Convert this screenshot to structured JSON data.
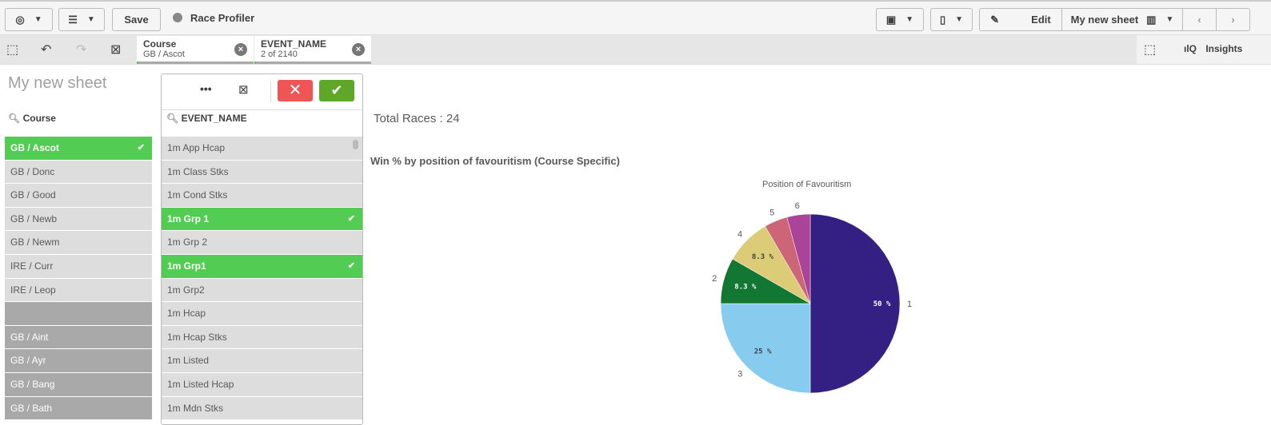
{
  "toolbar": {
    "save": "Save",
    "app_name": "Race Profiler",
    "edit": "Edit",
    "sheet_name": "My new sheet"
  },
  "selections": {
    "chips": [
      {
        "title": "Course",
        "value": "GB / Ascot"
      },
      {
        "title": "EVENT_NAME",
        "value": "2 of 2140"
      }
    ],
    "insights": "Insights"
  },
  "sheet": {
    "title": "My new sheet"
  },
  "course_list": {
    "title": "Course",
    "items": [
      {
        "label": "GB / Ascot",
        "state": "selected"
      },
      {
        "label": "GB / Donc",
        "state": "possible"
      },
      {
        "label": "GB / Good",
        "state": "possible"
      },
      {
        "label": "GB / Newb",
        "state": "possible"
      },
      {
        "label": "GB / Newm",
        "state": "possible"
      },
      {
        "label": "IRE / Curr",
        "state": "possible"
      },
      {
        "label": "IRE / Leop",
        "state": "possible"
      },
      {
        "label": "",
        "state": "alternative"
      },
      {
        "label": "GB / Aint",
        "state": "alternative"
      },
      {
        "label": "GB / Ayr",
        "state": "alternative"
      },
      {
        "label": "GB / Bang",
        "state": "alternative"
      },
      {
        "label": "GB / Bath",
        "state": "alternative"
      }
    ]
  },
  "event_list": {
    "title": "EVENT_NAME",
    "items": [
      {
        "label": "1m App Hcap",
        "state": "possible"
      },
      {
        "label": "1m Class Stks",
        "state": "possible"
      },
      {
        "label": "1m Cond Stks",
        "state": "possible"
      },
      {
        "label": "1m Grp 1",
        "state": "selected"
      },
      {
        "label": "1m Grp 2",
        "state": "possible"
      },
      {
        "label": "1m Grp1",
        "state": "selected"
      },
      {
        "label": "1m Grp2",
        "state": "possible"
      },
      {
        "label": "1m Hcap",
        "state": "possible"
      },
      {
        "label": "1m Hcap Stks",
        "state": "possible"
      },
      {
        "label": "1m Listed",
        "state": "possible"
      },
      {
        "label": "1m Listed Hcap",
        "state": "possible"
      },
      {
        "label": "1m Mdn Stks",
        "state": "possible"
      }
    ]
  },
  "kpi": {
    "text": "Total Races : 24"
  },
  "colors": {
    "selected": "#52cc52",
    "cancel": "#f05555",
    "confirm": "#5fa728"
  },
  "chart_data": {
    "type": "pie",
    "title": "Win % by position of favouritism (Course Specific)",
    "legend_title": "Position of Favouritism",
    "slices": [
      {
        "label": "1",
        "value": 50,
        "display": "50 %",
        "color": "#332082"
      },
      {
        "label": "3",
        "value": 25,
        "display": "25 %",
        "color": "#87ccee"
      },
      {
        "label": "2",
        "value": 8.3,
        "display": "8.3 %",
        "color": "#117733"
      },
      {
        "label": "4",
        "value": 8.3,
        "display": "8.3 %",
        "color": "#ddcc77"
      },
      {
        "label": "5",
        "value": 4.2,
        "display": "",
        "color": "#cc6677"
      },
      {
        "label": "6",
        "value": 4.2,
        "display": "",
        "color": "#aa4499"
      }
    ]
  }
}
